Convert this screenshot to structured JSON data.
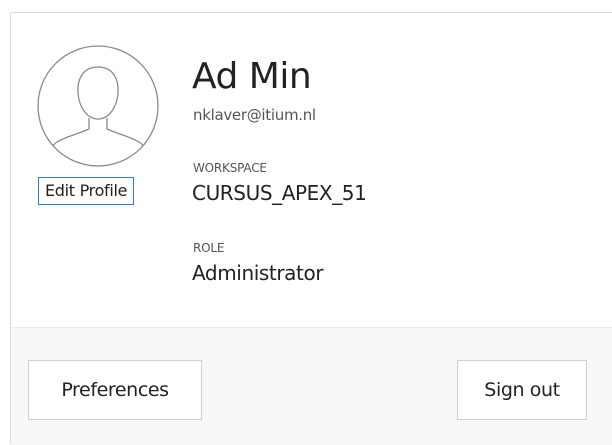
{
  "user": {
    "name": "Ad Min",
    "email": "nklaver@itium.nl",
    "edit_profile_label": "Edit Profile"
  },
  "workspace": {
    "label": "WORKSPACE",
    "value": "CURSUS_APEX_51"
  },
  "role": {
    "label": "ROLE",
    "value": "Administrator"
  },
  "actions": {
    "preferences_label": "Preferences",
    "sign_out_label": "Sign out"
  },
  "icons": {
    "avatar": "user-avatar-icon"
  }
}
